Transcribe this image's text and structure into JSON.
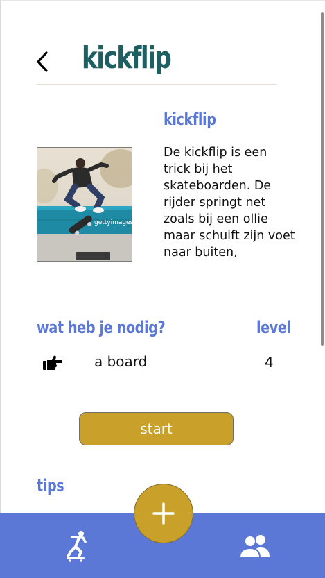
{
  "header": {
    "title": "kickflip",
    "back_icon": "chevron-left-icon"
  },
  "trick": {
    "heading": "kickflip",
    "image_caption": "gettyimages",
    "description": "De kickflip is een trick bij het skateboarden. De rijder springt net zoals bij een ollie maar schuift zijn voet naar buiten,"
  },
  "requirements": {
    "heading": "wat heb je nodig?",
    "level_heading": "level",
    "items": [
      {
        "icon": "pointing-hand-icon",
        "label": "a board",
        "level": "4"
      }
    ]
  },
  "start_button": {
    "label": "start"
  },
  "tips": {
    "heading": "tips"
  },
  "bottom_nav": {
    "left_icon": "skater-icon",
    "center_icon": "plus-icon",
    "right_icon": "users-icon"
  },
  "colors": {
    "title": "#1e5f61",
    "accent_blue": "#5b78d6",
    "accent_gold": "#c9a02a"
  }
}
